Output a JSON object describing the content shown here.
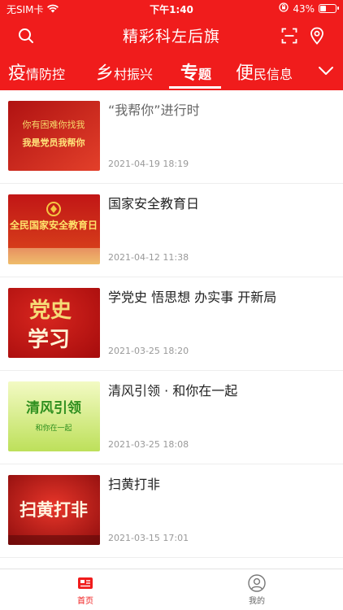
{
  "status_bar": {
    "carrier": "无SIM卡",
    "time": "下午1:40",
    "battery": "43%",
    "battery_level": 0.43
  },
  "header": {
    "title": "精彩科左后旗",
    "search_icon": "search-icon",
    "scan_icon": "scan-icon",
    "location_icon": "location-icon"
  },
  "tabs": [
    {
      "big": "疫",
      "small": "情防控"
    },
    {
      "big": "乡",
      "small": "村振兴"
    },
    {
      "big": "专",
      "small": "题"
    },
    {
      "big": "便",
      "small": "民信息"
    }
  ],
  "active_tab": "专题",
  "articles": [
    {
      "title": "“我帮你”进行时",
      "date": "2021-04-19 18:19",
      "thumb_text": [
        "你有困难你找我",
        "我是党员我帮你"
      ],
      "thumb_colors": [
        "#b01212",
        "#e3402a"
      ]
    },
    {
      "title": "国家安全教育日",
      "date": "2021-04-12 11:38",
      "thumb_text": [
        "全民国家安全教育日"
      ],
      "thumb_colors": [
        "#c11616",
        "#e7a433"
      ]
    },
    {
      "title": "学党史 悟思想 办实事 开新局",
      "date": "2021-03-25 18:20",
      "thumb_text": [
        "党史",
        "学习"
      ],
      "thumb_colors": [
        "#c51a1a",
        "#a80d0d"
      ]
    },
    {
      "title": "清风引领 · 和你在一起",
      "date": "2021-03-25 18:08",
      "thumb_text": [
        "清风引领",
        "和你在一起"
      ],
      "thumb_colors": [
        "#eef7b0",
        "#bde05a"
      ]
    },
    {
      "title": "扫黄打非",
      "date": "2021-03-15 17:01",
      "thumb_text": [
        "扫黄打非"
      ],
      "thumb_colors": [
        "#d21c1c",
        "#8d0d0d"
      ]
    }
  ],
  "bottom_nav": [
    {
      "label": "首页",
      "icon": "home-news-icon",
      "active": true
    },
    {
      "label": "我的",
      "icon": "profile-icon",
      "active": false
    }
  ],
  "colors": {
    "brand_red": "#f01c1c",
    "text_dark": "#222222",
    "date_gray": "#999999"
  }
}
